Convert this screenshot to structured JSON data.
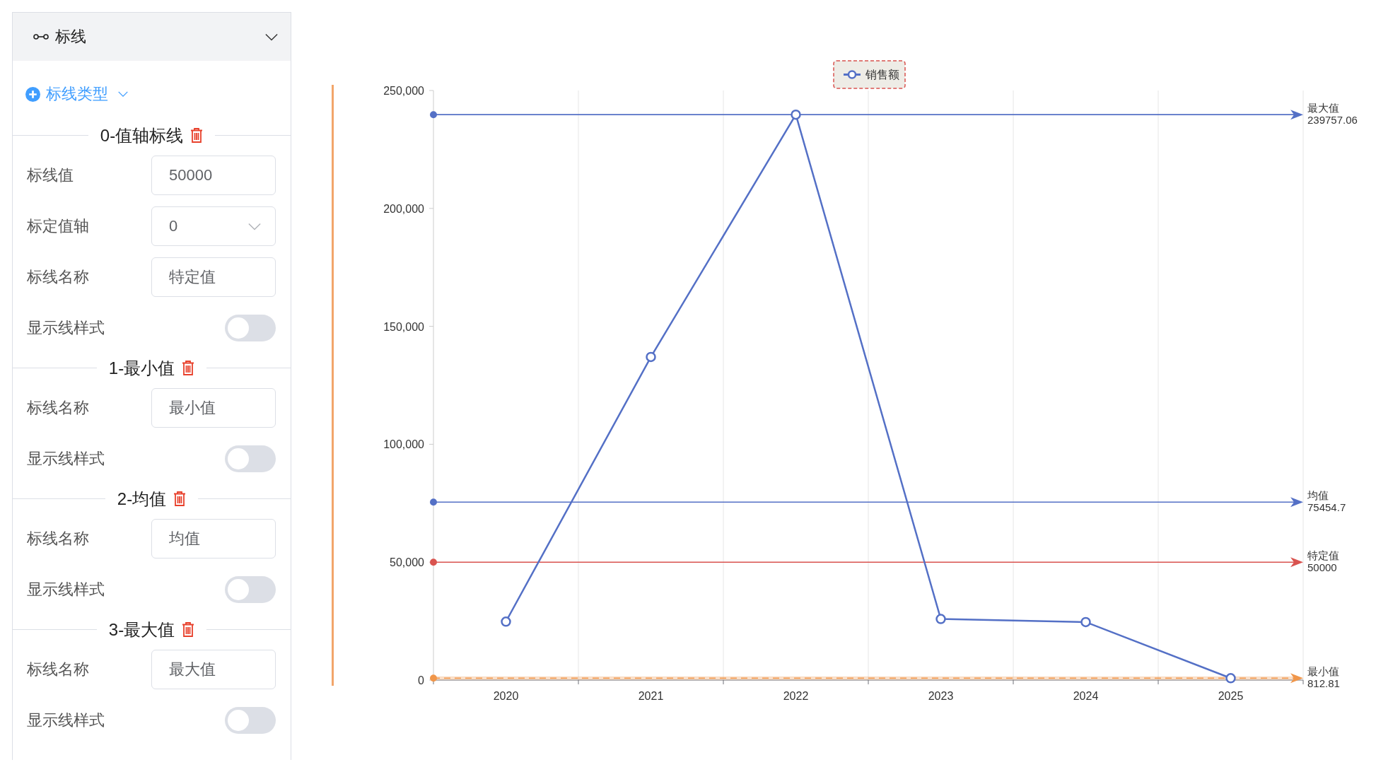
{
  "panel": {
    "title": "标线",
    "add_button": "标线类型",
    "sections": [
      {
        "title": "0-值轴标线",
        "fields": [
          {
            "kind": "input",
            "label": "标线值",
            "value": "50000"
          },
          {
            "kind": "select",
            "label": "标定值轴",
            "value": "0"
          },
          {
            "kind": "input",
            "label": "标线名称",
            "value": "特定值"
          },
          {
            "kind": "toggle",
            "label": "显示线样式",
            "on": false
          }
        ]
      },
      {
        "title": "1-最小值",
        "fields": [
          {
            "kind": "input",
            "label": "标线名称",
            "value": "最小值"
          },
          {
            "kind": "toggle",
            "label": "显示线样式",
            "on": false
          }
        ]
      },
      {
        "title": "2-均值",
        "fields": [
          {
            "kind": "input",
            "label": "标线名称",
            "value": "均值"
          },
          {
            "kind": "toggle",
            "label": "显示线样式",
            "on": false
          }
        ]
      },
      {
        "title": "3-最大值",
        "fields": [
          {
            "kind": "input",
            "label": "标线名称",
            "value": "最大值"
          },
          {
            "kind": "toggle",
            "label": "显示线样式",
            "on": false
          }
        ]
      }
    ]
  },
  "chart": {
    "legend": {
      "highlighted": true
    },
    "chart_data": {
      "type": "line",
      "categories": [
        "2020",
        "2021",
        "2022",
        "2023",
        "2024",
        "2025"
      ],
      "series": [
        {
          "name": "销售额",
          "color": "#5470c6",
          "marker": "circle",
          "values": [
            24800,
            137000,
            239757.06,
            25900,
            24600,
            812.81
          ]
        }
      ],
      "ylim": [
        0,
        250000
      ],
      "yticks": [
        {
          "value": 0,
          "label": "0"
        },
        {
          "value": 50000,
          "label": "50,000"
        },
        {
          "value": 100000,
          "label": "100,000"
        },
        {
          "value": 150000,
          "label": "150,000"
        },
        {
          "value": 200000,
          "label": "200,000"
        },
        {
          "value": 250000,
          "label": "250,000"
        }
      ],
      "ref_lines": [
        {
          "axis": "y",
          "value": 239757.06,
          "label": "最大值\n239757.06",
          "color": "#5470c6"
        },
        {
          "axis": "y",
          "value": 75454.7,
          "label": "均值\n75454.7",
          "color": "#5470c6"
        },
        {
          "axis": "y",
          "value": 50000,
          "label": "特定值\n50000",
          "color": "#d9534f"
        },
        {
          "axis": "y",
          "value": 812.81,
          "label": "最小值\n812.81",
          "color": "#f0964a"
        }
      ]
    }
  }
}
